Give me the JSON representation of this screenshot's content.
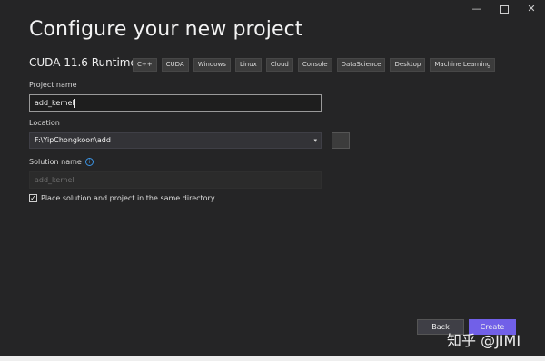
{
  "window": {
    "minimize_glyph": "—",
    "close_glyph": "✕"
  },
  "header": {
    "title": "Configure your new project",
    "template_name": "CUDA 11.6 Runtime",
    "tags": [
      "C++",
      "CUDA",
      "Windows",
      "Linux",
      "Cloud",
      "Console",
      "DataScience",
      "Desktop",
      "Machine Learning"
    ]
  },
  "form": {
    "project_name_label": "Project name",
    "project_name_value": "add_kernel",
    "location_label": "Location",
    "location_value": "F:\\YipChongkoon\\add",
    "browse_label": "...",
    "solution_name_label": "Solution name",
    "solution_name_info": "i",
    "solution_name_placeholder": "add_kernel",
    "same_dir_label": "Place solution and project in the same directory",
    "same_dir_checked": true,
    "check_glyph": "✓"
  },
  "footer": {
    "back_label": "Back",
    "create_label": "Create"
  },
  "overlay": {
    "watermark": "知乎 @JIMI"
  },
  "colors": {
    "window_bg": "#252526",
    "accent": "#7160e8",
    "info": "#3b95e6"
  }
}
